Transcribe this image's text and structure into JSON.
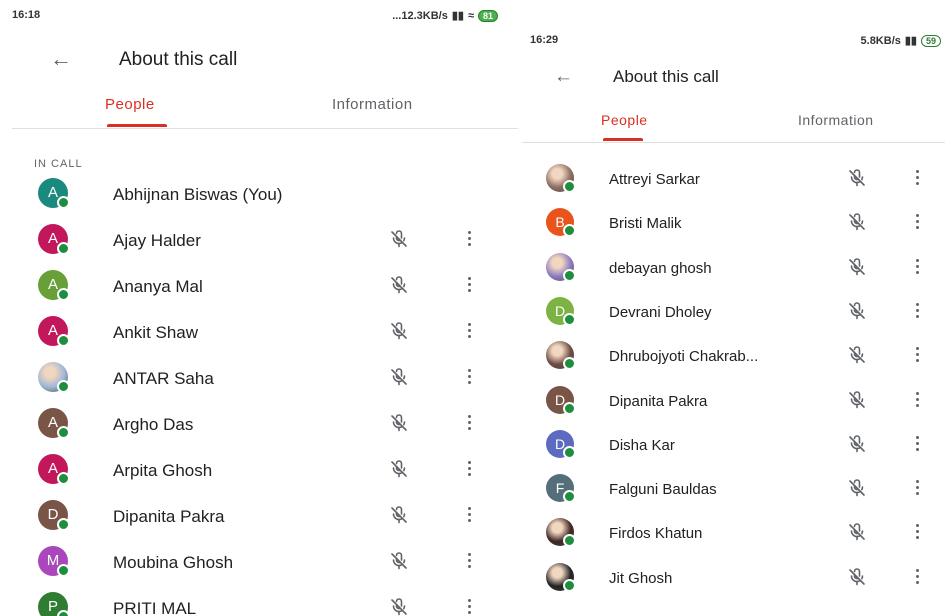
{
  "left": {
    "status": {
      "time": "16:18",
      "network": "...12.3KB/s",
      "battery": "81"
    },
    "title": "About this call",
    "tabs": [
      "People",
      "Information"
    ],
    "section": "IN CALL",
    "participants": [
      {
        "name": "Abhijnan Biswas (You)",
        "initial": "A",
        "color": "#1a8a7e",
        "is_you": true
      },
      {
        "name": "Ajay Halder",
        "initial": "A",
        "color": "#c2185b"
      },
      {
        "name": "Ananya Mal",
        "initial": "A",
        "color": "#689f38"
      },
      {
        "name": "Ankit Shaw",
        "initial": "A",
        "color": "#c2185b"
      },
      {
        "name": "ANTAR Saha",
        "initial": "",
        "color": "#9fb8d6",
        "photo": true
      },
      {
        "name": "Argho Das",
        "initial": "A",
        "color": "#795548"
      },
      {
        "name": "Arpita Ghosh",
        "initial": "A",
        "color": "#c2185b"
      },
      {
        "name": "Dipanita Pakra",
        "initial": "D",
        "color": "#795548"
      },
      {
        "name": "Moubina Ghosh",
        "initial": "M",
        "color": "#ab47bc"
      },
      {
        "name": "PRITI MAL",
        "initial": "P",
        "color": "#2e7d32"
      }
    ]
  },
  "right": {
    "status": {
      "time": "16:29",
      "network": "5.8KB/s",
      "battery": "59"
    },
    "title": "About this call",
    "tabs": [
      "People",
      "Information"
    ],
    "participants": [
      {
        "name": "Attreyi Sarkar",
        "initial": "",
        "color": "#8d6e63",
        "photo": true
      },
      {
        "name": "Bristi Malik",
        "initial": "B",
        "color": "#e8541c"
      },
      {
        "name": "debayan ghosh",
        "initial": "",
        "color": "#8e7cc3",
        "photo": true
      },
      {
        "name": "Devrani Dholey",
        "initial": "D",
        "color": "#7cb342"
      },
      {
        "name": "Dhrubojyoti Chakrab...",
        "initial": "",
        "color": "#6d4c41",
        "photo": true
      },
      {
        "name": "Dipanita Pakra",
        "initial": "D",
        "color": "#795548"
      },
      {
        "name": "Disha Kar",
        "initial": "D",
        "color": "#5c6bc0"
      },
      {
        "name": "Falguni Bauldas",
        "initial": "F",
        "color": "#546e7a"
      },
      {
        "name": "Firdos Khatun",
        "initial": "",
        "color": "#3e2723",
        "photo": true
      },
      {
        "name": "Jit Ghosh",
        "initial": "",
        "color": "#222222",
        "photo": true
      }
    ]
  }
}
